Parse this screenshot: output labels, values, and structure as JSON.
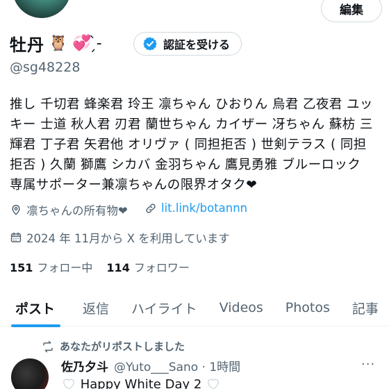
{
  "profile": {
    "edit_label": "編集",
    "display_name": "牡丹",
    "name_emojis": "🦉 💞 ̗̀-",
    "verify_label": "認証を受ける",
    "handle": "@sg48228",
    "bio_lines": [
      "推し 千切君 蜂楽君 玲王 凛ちゃん ひおりん 烏君 乙夜君 ユッ",
      "キー 士道 秋人君 刃君 蘭世ちゃん カイザー 冴ちゃん 蘇枋 三",
      "輝君 丁子君 矢君他 オリヴァ ( 同担拒否 ) 世剣テラス ( 同担",
      "拒否 ) 久蘭 獅鷹 シカバ 金羽ちゃん 鷹見勇雅 ブルーロック",
      "専属サポーター兼凛ちゃんの限界オタク❤"
    ],
    "location": "凛ちゃんの所有物❤",
    "link": "lit.link/botannn",
    "joined": "2024 年 11月から X を利用しています",
    "following_count": "151",
    "following_label": "フォロー中",
    "followers_count": "114",
    "followers_label": "フォロワー"
  },
  "tabs": [
    {
      "label": "ポスト",
      "active": true
    },
    {
      "label": "返信",
      "active": false
    },
    {
      "label": "ハイライト",
      "active": false
    },
    {
      "label": "Videos",
      "active": false
    },
    {
      "label": "Photos",
      "active": false
    },
    {
      "label": "記事",
      "active": false
    }
  ],
  "post": {
    "repost_label": "あなたがリポストしました",
    "author_name": "佐乃夕斗",
    "author_meta": "@Yuto___Sano · 1時間",
    "more": "···",
    "text": "Happy White Day 2"
  },
  "colors": {
    "accent": "#1d9bf0",
    "secondary_text": "#536471",
    "border": "#cfd9de"
  },
  "icons": [
    "location-icon",
    "link-icon",
    "calendar-icon",
    "verified-badge-icon",
    "repost-icon",
    "more-icon"
  ]
}
